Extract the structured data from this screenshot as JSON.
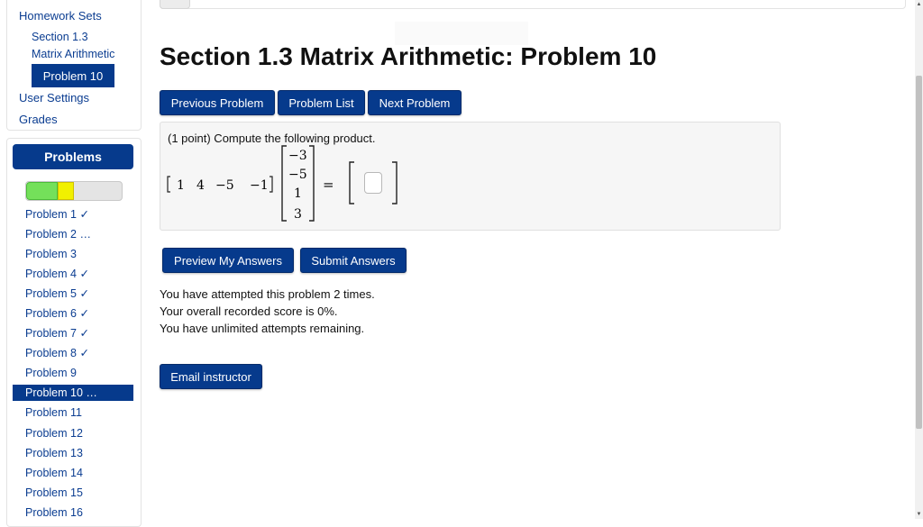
{
  "nav": {
    "homework_sets": "Homework Sets",
    "section_line1": "Section 1.3",
    "section_line2": "Matrix Arithmetic",
    "current_problem": "Problem 10",
    "user_settings": "User Settings",
    "grades": "Grades"
  },
  "problems_panel": {
    "heading": "Problems",
    "progress": {
      "correct_fraction": 0.33,
      "attempted_fraction": 0.17
    },
    "items": [
      {
        "label": "Problem 1 ✓"
      },
      {
        "label": "Problem 2 …"
      },
      {
        "label": "Problem 3"
      },
      {
        "label": "Problem 4 ✓"
      },
      {
        "label": "Problem 5 ✓"
      },
      {
        "label": "Problem 6 ✓"
      },
      {
        "label": "Problem 7 ✓"
      },
      {
        "label": "Problem 8 ✓"
      },
      {
        "label": "Problem 9"
      },
      {
        "label": "Problem 10 …",
        "current": true
      },
      {
        "label": "Problem 11"
      },
      {
        "label": "Problem 12"
      },
      {
        "label": "Problem 13"
      },
      {
        "label": "Problem 14"
      },
      {
        "label": "Problem 15"
      },
      {
        "label": "Problem 16"
      }
    ]
  },
  "main": {
    "title": "Section 1.3 Matrix Arithmetic: Problem 10",
    "nav_buttons": {
      "previous": "Previous Problem",
      "list": "Problem List",
      "next": "Next Problem"
    },
    "problem": {
      "prompt": "(1 point) Compute the following product.",
      "row_vector": [
        "1",
        "4",
        "−5",
        "−1"
      ],
      "column_vector": [
        "−3",
        "−5",
        "1",
        "3"
      ],
      "equals": "=",
      "answer_value": ""
    },
    "action_buttons": {
      "preview": "Preview My Answers",
      "submit": "Submit Answers"
    },
    "status": {
      "attempts": "You have attempted this problem 2 times.",
      "score": "Your overall recorded score is 0%.",
      "remaining": "You have unlimited attempts remaining."
    },
    "email_button": "Email instructor"
  },
  "colors": {
    "primary": "#063a8c",
    "link": "#0b3d91",
    "progress_correct": "#74e05a",
    "progress_attempted": "#f1f000"
  }
}
